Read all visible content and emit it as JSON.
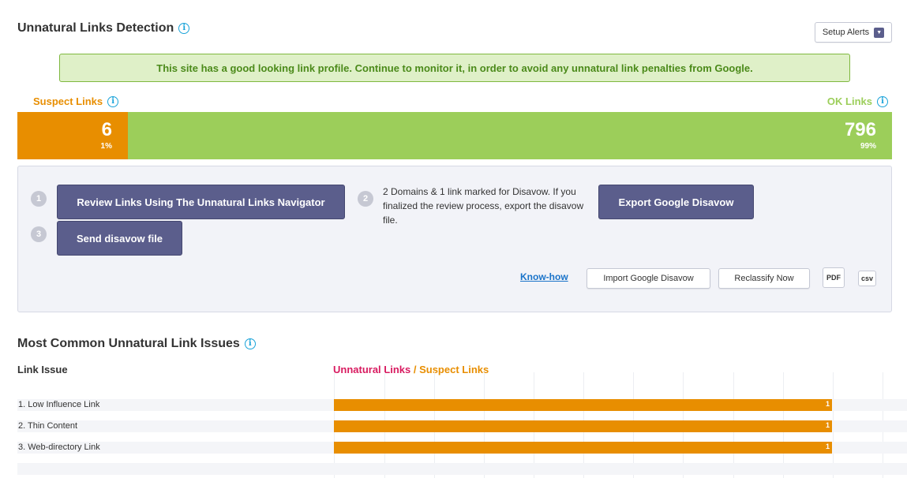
{
  "header": {
    "title": "Unnatural Links Detection",
    "setup_alerts_label": "Setup Alerts"
  },
  "banner": {
    "message": "This site has a good looking link profile. Continue to monitor it, in order to avoid any unnatural link penalties from Google."
  },
  "summary": {
    "suspect_label": "Suspect Links",
    "suspect_count": "6",
    "suspect_percent": "1%",
    "ok_label": "OK Links",
    "ok_count": "796",
    "ok_percent": "99%",
    "suspect_fraction": 0.01
  },
  "steps": {
    "step1_number": "1",
    "step1_button": "Review Links Using The Unnatural Links Navigator",
    "step2_number": "2",
    "step2_text": "2 Domains & 1 link marked for Disavow. If you finalized the review process, export the disavow file.",
    "step2_button": "Export Google Disavow",
    "step3_number": "3",
    "step3_button": "Send disavow file"
  },
  "actions": {
    "know_how": "Know-how",
    "import_label": "Import Google Disavow",
    "reclassify_label": "Reclassify Now",
    "pdf_label": "PDF",
    "csv_label": "csv"
  },
  "issues": {
    "title": "Most Common Unnatural Link Issues",
    "column_header": "Link Issue",
    "legend_unnatural": "Unnatural Links",
    "legend_separator": " / ",
    "legend_suspect": "Suspect Links",
    "rows": [
      {
        "label": "1. Low Influence Link",
        "value": 1
      },
      {
        "label": "2. Thin Content",
        "value": 1
      },
      {
        "label": "3. Web-directory Link",
        "value": 1
      }
    ]
  },
  "colors": {
    "suspect": "#e88e00",
    "ok": "#9cce5a",
    "unnatural": "#d81b60",
    "button_dark": "#5b5e8c"
  }
}
